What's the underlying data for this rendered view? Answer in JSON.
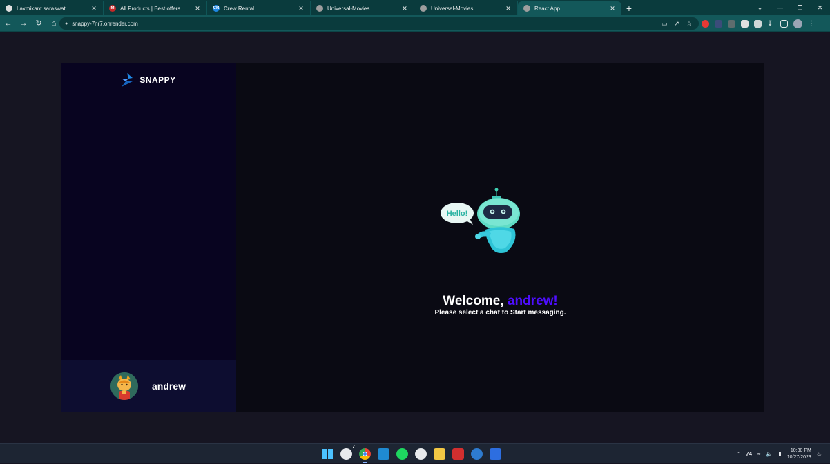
{
  "browser": {
    "tabs": [
      {
        "title": "Laxmikant saraswat",
        "favicon_color": "#e0e0e0",
        "favicon_glyph": "",
        "active": false
      },
      {
        "title": "All Products | Best offers",
        "favicon_color": "#c62828",
        "favicon_glyph": "M",
        "active": false
      },
      {
        "title": "Crew Rental",
        "favicon_color": "#1e88e5",
        "favicon_glyph": "CR",
        "active": false
      },
      {
        "title": "Universal-Movies",
        "favicon_color": "#9e9e9e",
        "favicon_glyph": "",
        "active": false
      },
      {
        "title": "Universal-Movies",
        "favicon_color": "#9e9e9e",
        "favicon_glyph": "",
        "active": false
      },
      {
        "title": "React App",
        "favicon_color": "#9e9e9e",
        "favicon_glyph": "",
        "active": true
      }
    ],
    "new_tab_label": "+",
    "url": "snappy-7nr7.onrender.com"
  },
  "app": {
    "brand": "SNAPPY",
    "current_user": "andrew",
    "welcome": {
      "prefix": "Welcome, ",
      "name": "andrew!",
      "subtitle": "Please select a chat to Start messaging.",
      "bubble_text": "Hello!"
    },
    "accent_color": "#4e0eff"
  },
  "taskbar": {
    "chrome_badge": "7",
    "temperature": "74",
    "time": "10:30 PM",
    "date": "10/27/2023"
  }
}
